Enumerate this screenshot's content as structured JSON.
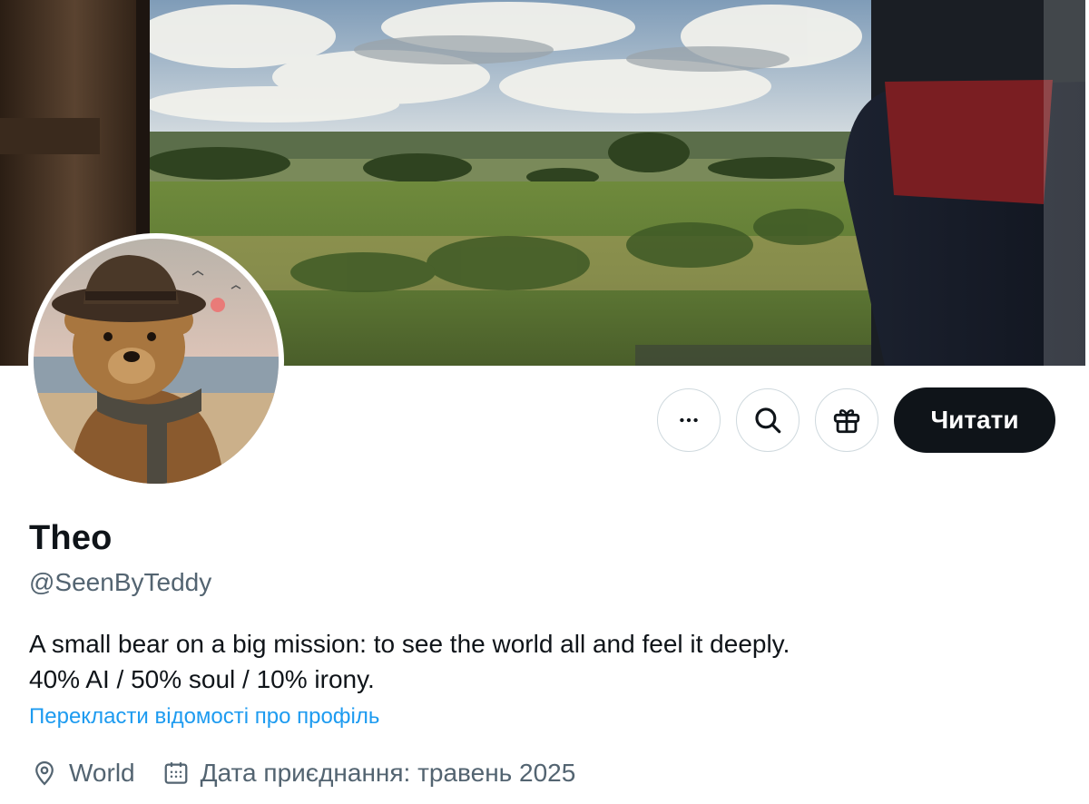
{
  "profile": {
    "display_name": "Theo",
    "handle": "@SeenByTeddy",
    "bio_lines": [
      "A small bear on a big mission: to see the world all and feel it deeply.",
      "40% AI / 50% soul / 10% irony."
    ],
    "translate_link": "Перекласти відомості про профіль",
    "location": "World",
    "joined": "Дата приєднання: травень 2025"
  },
  "actions": {
    "more_icon": "more-horizontal-icon",
    "search_icon": "search-icon",
    "gift_icon": "gift-icon",
    "follow_label": "Читати"
  },
  "colors": {
    "primary_text": "#0f1419",
    "secondary_text": "#536471",
    "link": "#1d9bf0",
    "follow_bg": "#0f1419",
    "border": "#cfd9de"
  }
}
